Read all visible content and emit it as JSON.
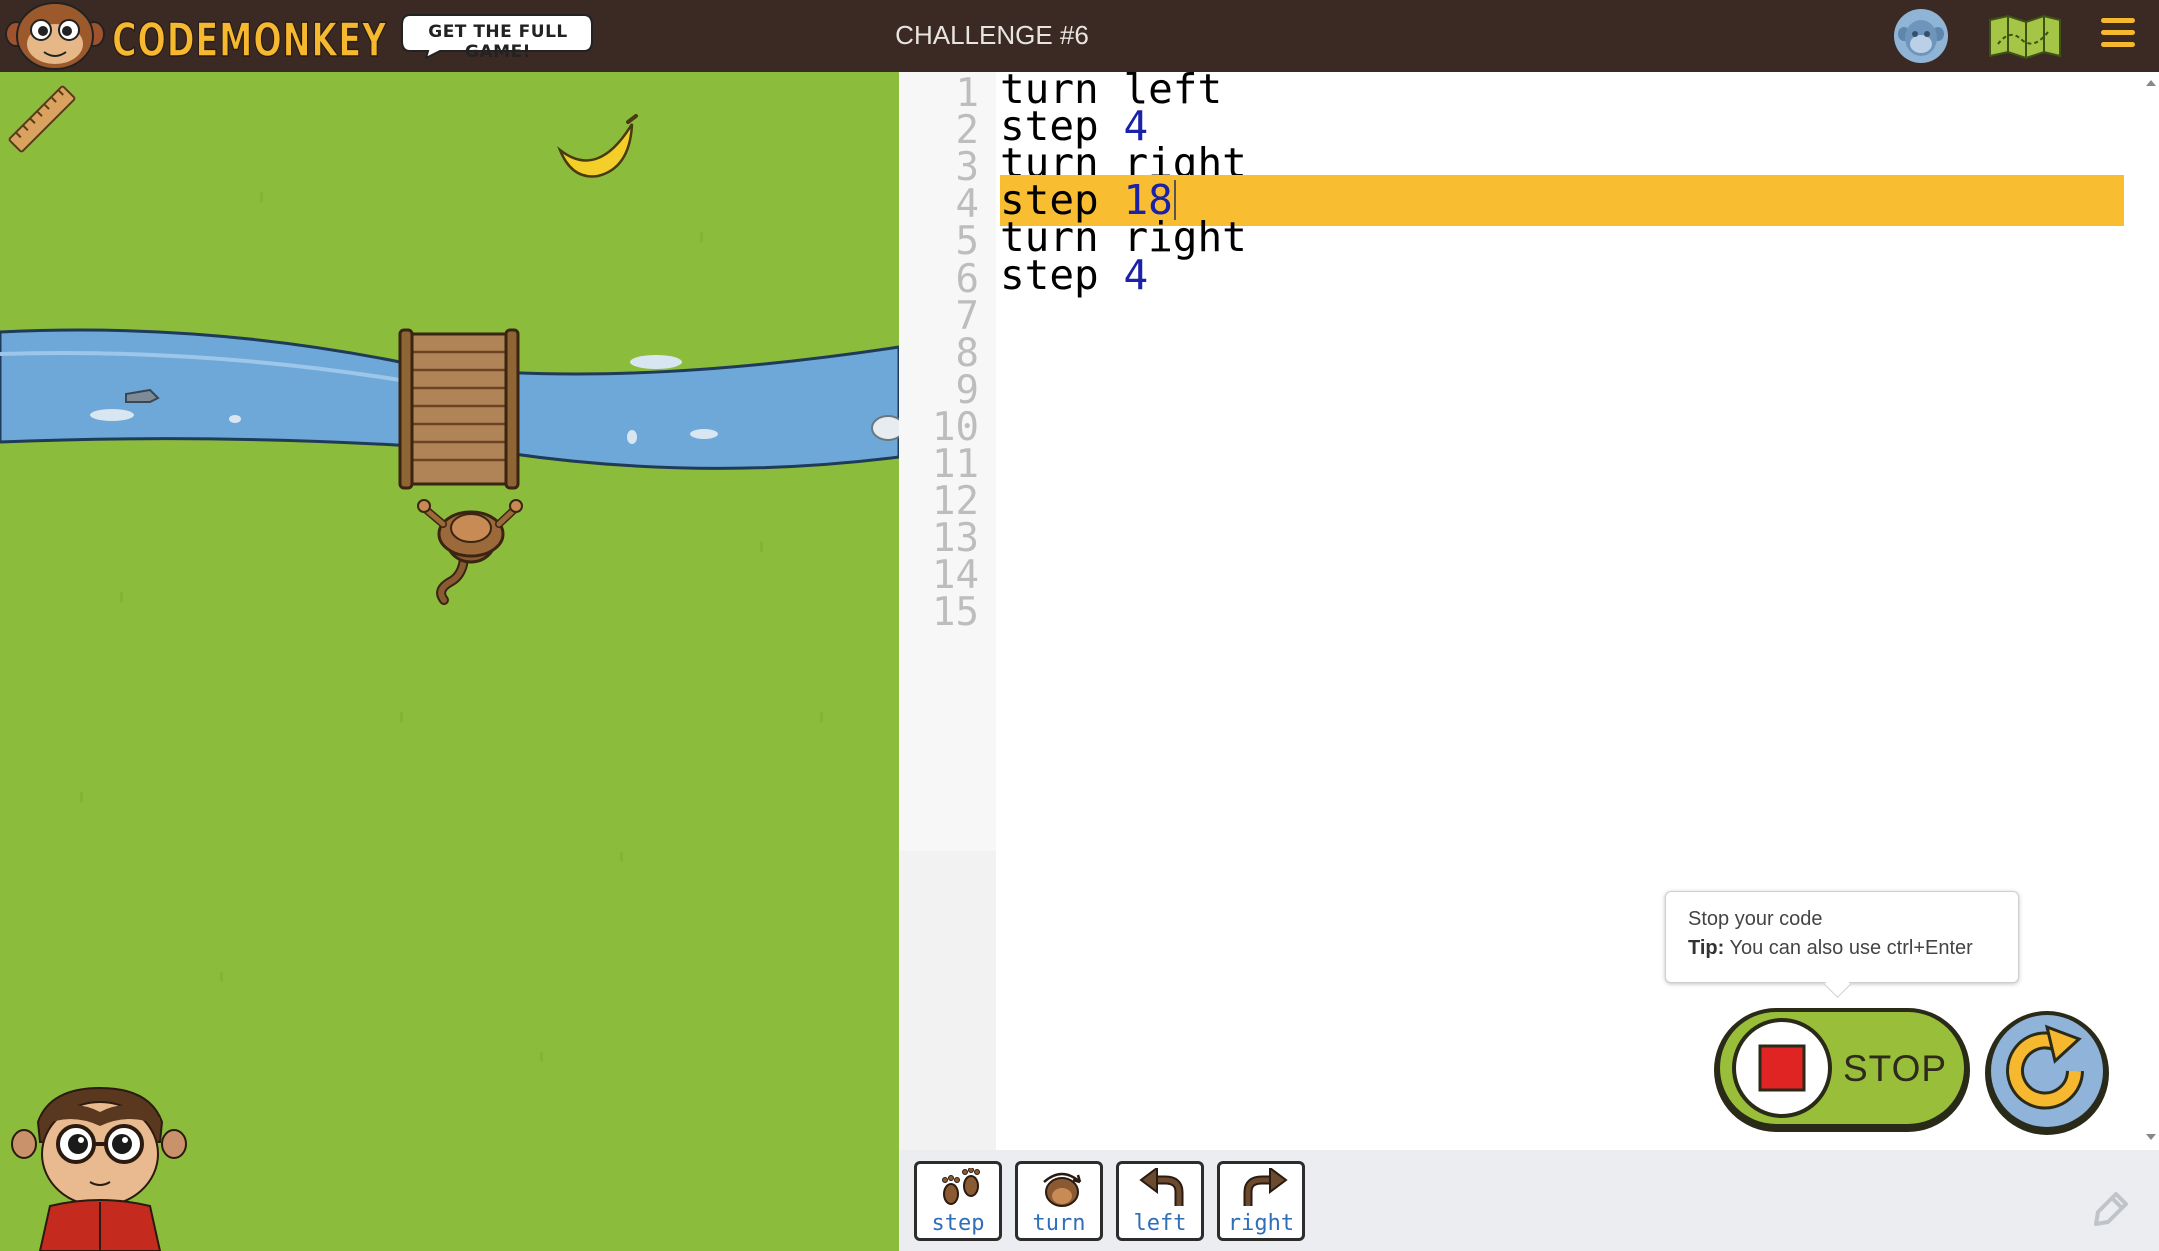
{
  "header": {
    "logo_text": "CODEMONKEY",
    "get_full_game_label": "GET THE FULL GAME!",
    "challenge_title": "CHALLENGE #6",
    "avatar_icon": "monkey-avatar-icon",
    "map_icon": "map-icon",
    "menu_icon": "hamburger-menu-icon"
  },
  "game": {
    "ruler_icon": "ruler-icon",
    "banana_icon": "banana-icon",
    "bridge_icon": "wooden-bridge-icon",
    "monkey_icon": "monkey-icon",
    "character_icon": "monkey-character-icon"
  },
  "editor": {
    "line_numbers": [
      "1",
      "2",
      "3",
      "4",
      "5",
      "6",
      "7",
      "8",
      "9",
      "10",
      "11",
      "12",
      "13",
      "14",
      "15"
    ],
    "lines": [
      {
        "cmd": "turn",
        "arg": "left",
        "arg_is_number": false
      },
      {
        "cmd": "step",
        "arg": "4",
        "arg_is_number": true
      },
      {
        "cmd": "turn",
        "arg": "right",
        "arg_is_number": false
      },
      {
        "cmd": "step",
        "arg": "18",
        "arg_is_number": true
      },
      {
        "cmd": "turn",
        "arg": "right",
        "arg_is_number": false
      },
      {
        "cmd": "step",
        "arg": "4",
        "arg_is_number": true
      }
    ],
    "highlighted_line": 4,
    "highlight_color": "#f9bd31",
    "number_color": "#1a22a8"
  },
  "tooltip": {
    "title": "Stop your code",
    "tip_label": "Tip:",
    "tip_text": "You can also use ctrl+Enter"
  },
  "controls": {
    "stop_label": "STOP",
    "stop_icon": "stop-square-icon",
    "reset_icon": "reset-arrow-icon"
  },
  "palette": {
    "commands": [
      {
        "label": "step",
        "icon": "footprints-icon"
      },
      {
        "label": "turn",
        "icon": "turn-head-icon"
      },
      {
        "label": "left",
        "icon": "left-arrow-icon"
      },
      {
        "label": "right",
        "icon": "right-arrow-icon"
      }
    ],
    "pencil_icon": "pencil-icon"
  },
  "colors": {
    "topbar": "#3b2a24",
    "grass": "#8cbc3c",
    "river": "#6ea8d8",
    "stop_button": "#98be3a",
    "reset_button": "#8fb3d9",
    "accent_yellow": "#f5b82e"
  }
}
